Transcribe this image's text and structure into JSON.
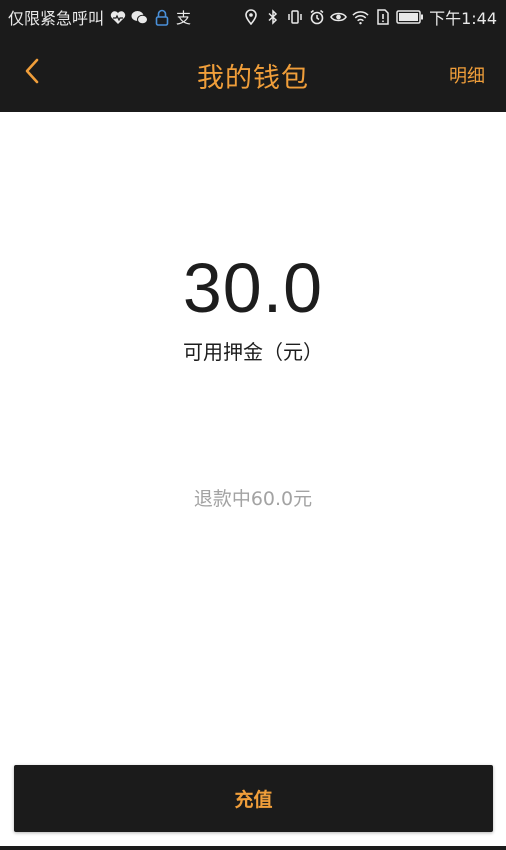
{
  "status_bar": {
    "carrier": "仅限紧急呼叫",
    "time": "下午1:44",
    "left_icons": [
      "heart-icon",
      "wechat-icon",
      "lock-icon",
      "alipay-icon"
    ],
    "alipay_glyph": "支",
    "right_icons": [
      "location-icon",
      "bluetooth-icon",
      "vibrate-icon",
      "alarm-icon",
      "eye-icon",
      "wifi-icon",
      "sim-icon",
      "battery-icon"
    ]
  },
  "nav": {
    "title": "我的钱包",
    "detail_label": "明细"
  },
  "wallet": {
    "balance": "30.0",
    "balance_label": "可用押金（元）",
    "refund_status": "退款中60.0元"
  },
  "actions": {
    "recharge_label": "充值"
  },
  "colors": {
    "accent": "#f09e3a",
    "bar_background": "#1b1b1b",
    "text_primary": "#1d1d1d",
    "text_muted": "#a3a3a3"
  }
}
